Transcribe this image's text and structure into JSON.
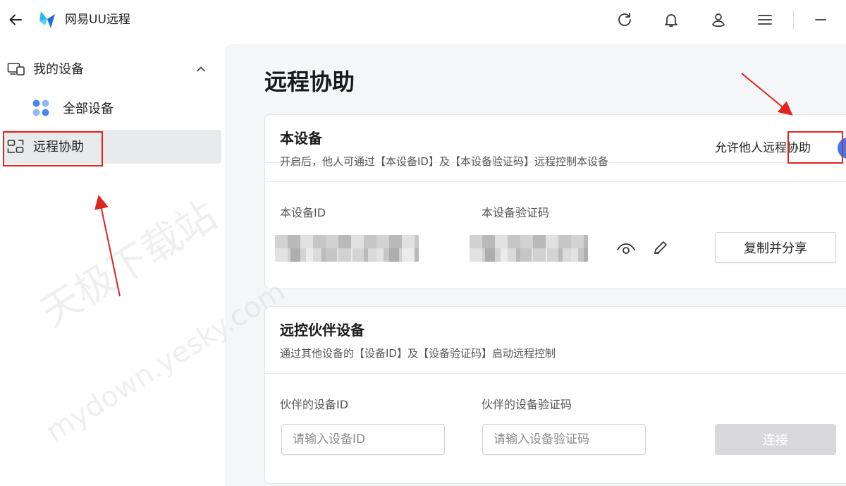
{
  "app": {
    "title": "网易UU远程"
  },
  "colors": {
    "accent": "#3a7cf1",
    "annotation": "#e0241e",
    "sidebar_active_bg": "#e9eaec",
    "main_bg": "#f5f6f8"
  },
  "titlebar": {
    "icons": [
      "back-arrow-icon",
      "uu-logo-icon",
      "refresh-icon",
      "bell-icon",
      "user-icon",
      "menu-icon",
      "minimize-icon"
    ]
  },
  "sidebar": {
    "group": {
      "label": "我的设备",
      "expanded": true,
      "icon": "devices-icon",
      "chevron": "chevron-up-icon"
    },
    "items": [
      {
        "label": "全部设备",
        "icon": "all-devices-icon"
      },
      {
        "label": "远程协助",
        "icon": "remote-assist-icon",
        "active": true
      }
    ]
  },
  "main": {
    "page_title": "远程协助",
    "local_card": {
      "title": "本设备",
      "desc": "开启后，他人可通过【本设备ID】及【本设备验证码】远程控制本设备",
      "toggle_label": "允许他人远程协助",
      "toggle_on": true,
      "device_id_label": "本设备ID",
      "code_label": "本设备验证码",
      "share_button": "复制并分享",
      "icons": [
        "eye-icon",
        "pencil-icon"
      ]
    },
    "partner_card": {
      "title": "远控伙伴设备",
      "desc": "通过其他设备的【设备ID】及【设备验证码】启动远程控制",
      "partner_id_label": "伙伴的设备ID",
      "partner_code_label": "伙伴的设备验证码",
      "partner_id_placeholder": "请输入设备ID",
      "partner_code_placeholder": "请输入设备验证码",
      "connect_button": "连接",
      "connect_enabled": false
    }
  },
  "watermark": {
    "line1": "天极下载站",
    "line2": "mydown.yesky.com"
  }
}
